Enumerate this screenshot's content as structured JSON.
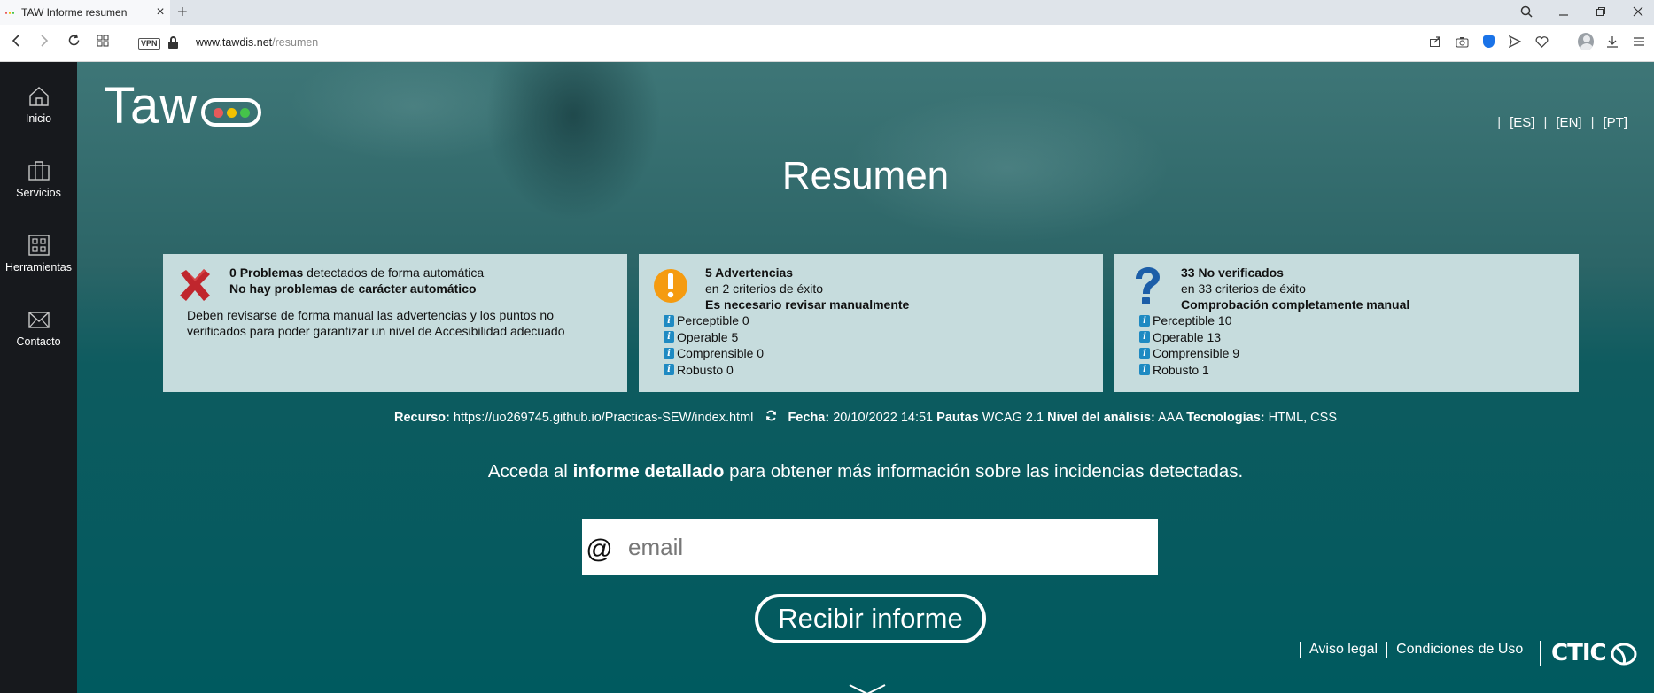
{
  "browser": {
    "tab_title": "TAW Informe resumen",
    "url_domain": "www.tawdis.net",
    "url_path": "/resumen",
    "vpn_label": "VPN"
  },
  "sidebar": {
    "items": [
      {
        "label": "Inicio",
        "icon": "home-icon"
      },
      {
        "label": "Servicios",
        "icon": "briefcase-icon"
      },
      {
        "label": "Herramientas",
        "icon": "grid-icon"
      },
      {
        "label": "Contacto",
        "icon": "mail-icon"
      }
    ]
  },
  "header": {
    "logo_text": "Taw",
    "languages": [
      "[ES]",
      "[EN]",
      "[PT]"
    ]
  },
  "page_title": "Resumen",
  "cards": {
    "problems": {
      "count": "0",
      "count_label": "Problemas",
      "count_suffix": "detectados de forma automática",
      "subtitle": "No hay problemas de carácter automático",
      "body": "Deben revisarse de forma manual las advertencias y los puntos no verificados para poder garantizar un nivel de Accesibilidad adecuado"
    },
    "warnings": {
      "title": "5 Advertencias",
      "line2": "en 2 criterios de éxito",
      "line3": "Es necesario revisar manualmente",
      "criteria": [
        "Perceptible 0",
        "Operable 5",
        "Comprensible 0",
        "Robusto 0"
      ]
    },
    "unverified": {
      "title": "33 No verificados",
      "line2": "en 33 criterios de éxito",
      "line3": "Comprobación completamente manual",
      "criteria": [
        "Perceptible 10",
        "Operable 13",
        "Comprensible 9",
        "Robusto 1"
      ]
    }
  },
  "resource": {
    "resource_label": "Recurso:",
    "resource_value": "https://uo269745.github.io/Practicas-SEW/index.html",
    "date_label": "Fecha:",
    "date_value": "20/10/2022 14:51",
    "guidelines_label": "Pautas",
    "guidelines_value": "WCAG 2.1",
    "level_label": "Nivel del análisis:",
    "level_value": "AAA",
    "tech_label": "Tecnologías:",
    "tech_value": "HTML, CSS"
  },
  "cta": {
    "prefix": "Acceda al",
    "bold": "informe detallado",
    "suffix": "para obtener más información sobre las incidencias detectadas."
  },
  "email": {
    "at_symbol": "@",
    "placeholder": "email",
    "value": ""
  },
  "submit_label": "Recibir informe",
  "footer": {
    "legal": "Aviso legal",
    "terms": "Condiciones de Uso",
    "brand": "CTIC"
  },
  "colors": {
    "teal": "#005a5f",
    "sidebar": "#17191d",
    "card": "#c6dcdd",
    "info_icon": "#1e8ac2",
    "error_icon": "#c0262d",
    "warning_icon": "#f59b10",
    "question_icon": "#1c5ea8",
    "light_red": "#e85a5a",
    "light_yellow": "#f2c200",
    "light_green": "#45c34a"
  }
}
